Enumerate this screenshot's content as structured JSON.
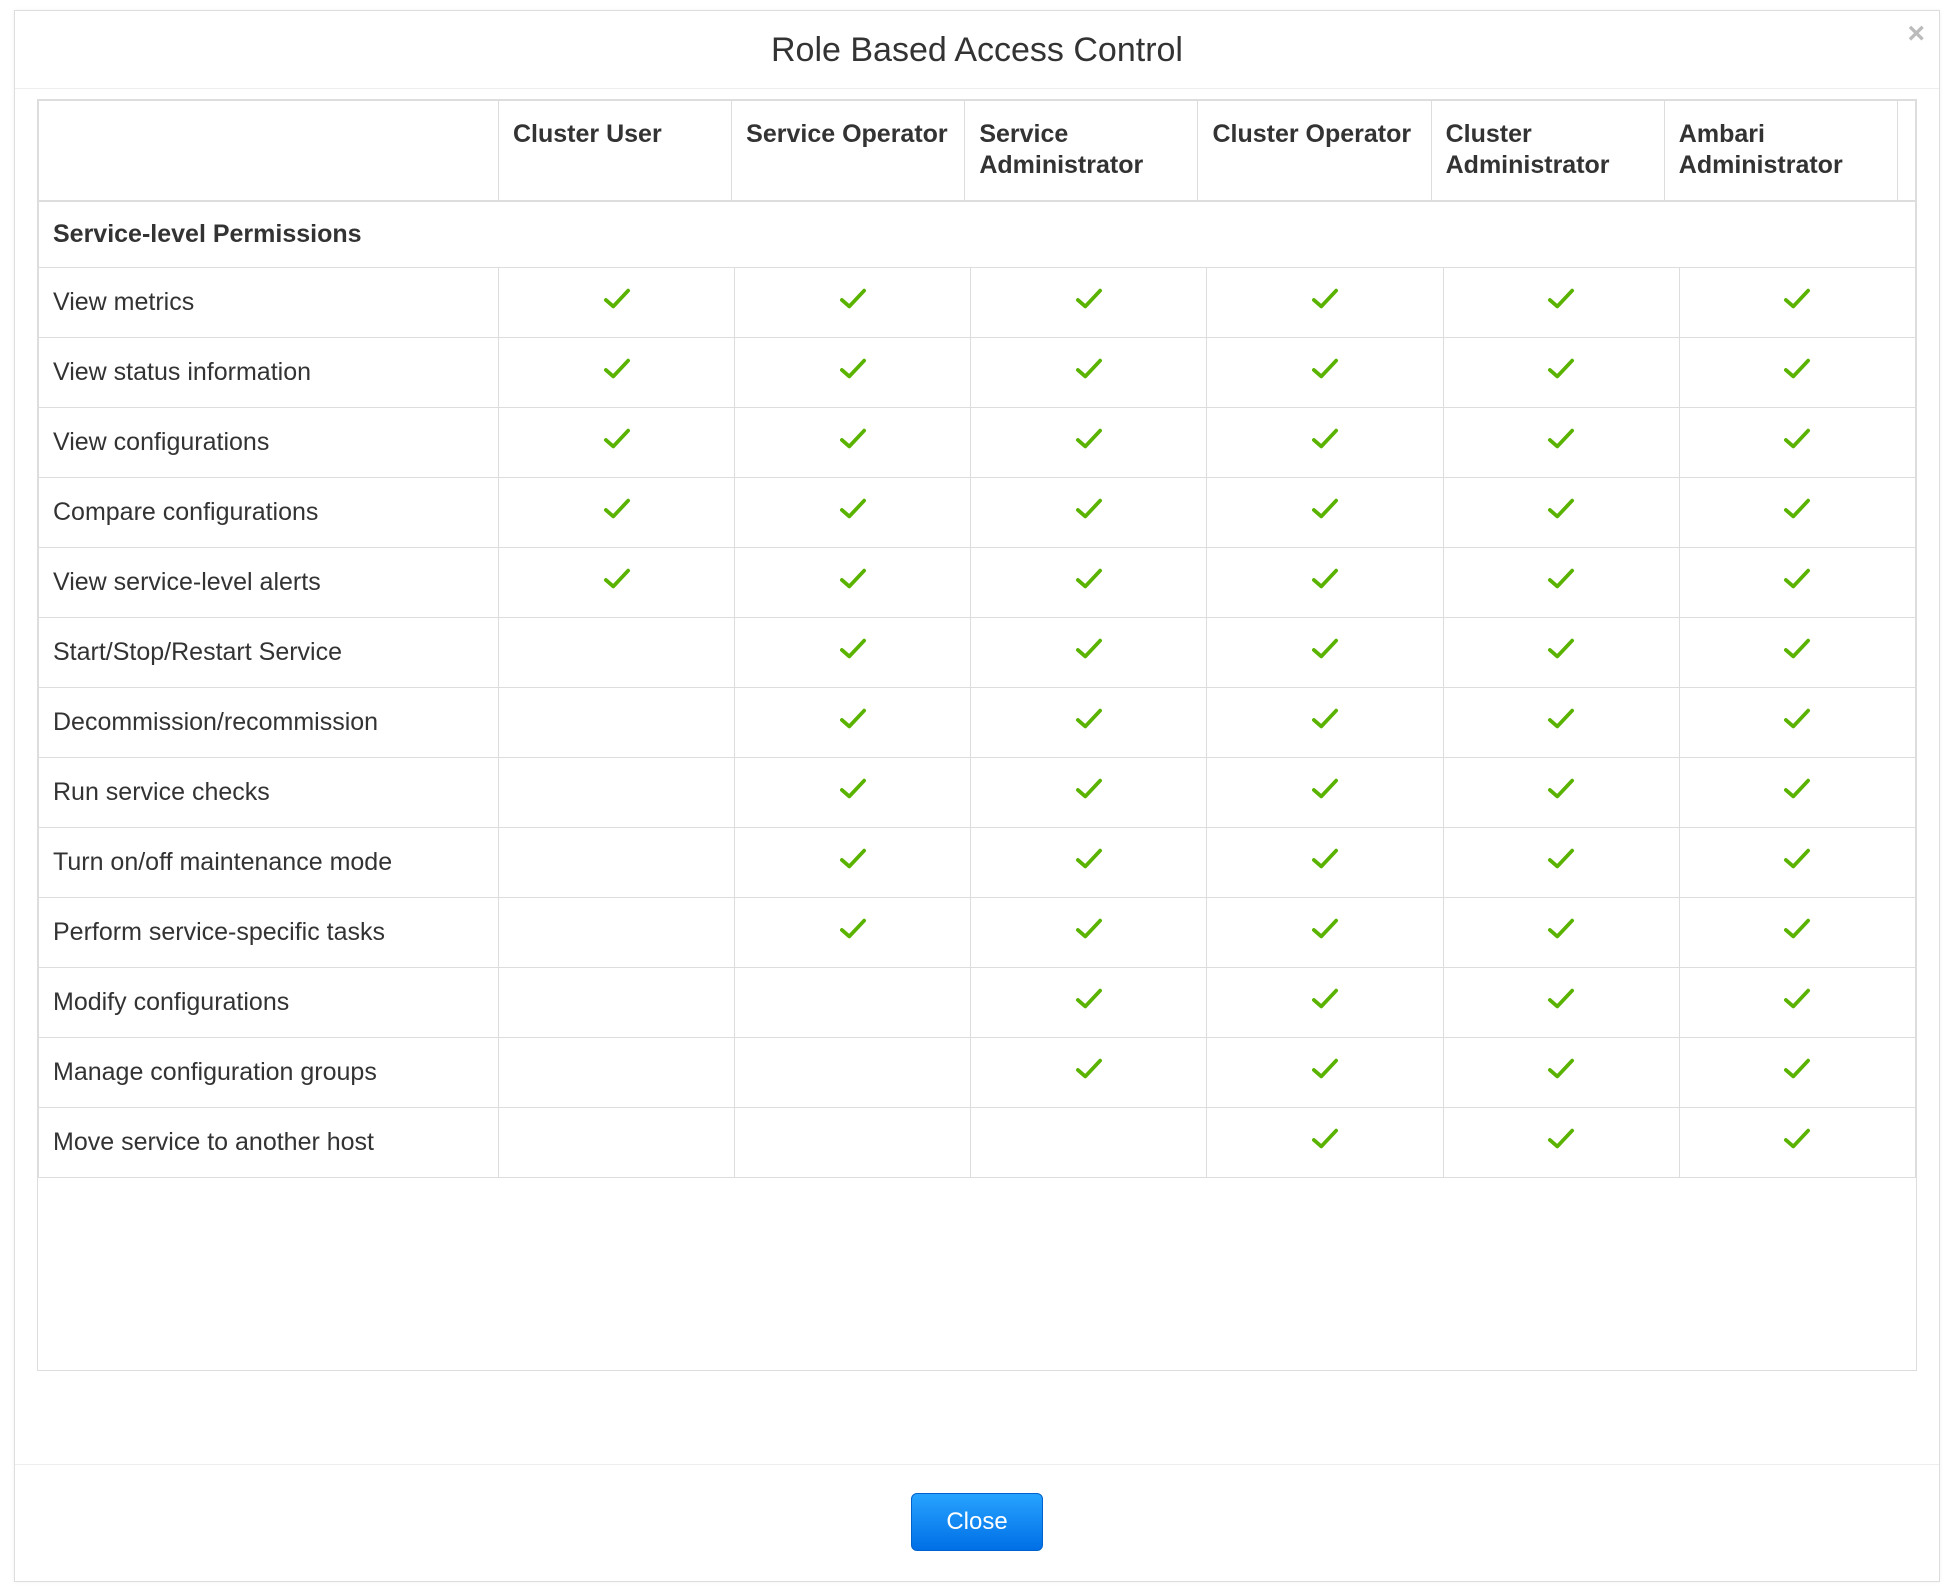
{
  "modal": {
    "title": "Role Based Access Control",
    "close_button_label": "Close",
    "roles": [
      "Cluster User",
      "Service Operator",
      "Service Administrator",
      "Cluster Operator",
      "Cluster Administrator",
      "Ambari Administrator"
    ],
    "section_label": "Service-level Permissions",
    "permissions": [
      {
        "name": "View metrics",
        "grants": [
          true,
          true,
          true,
          true,
          true,
          true
        ]
      },
      {
        "name": "View status information",
        "grants": [
          true,
          true,
          true,
          true,
          true,
          true
        ]
      },
      {
        "name": "View configurations",
        "grants": [
          true,
          true,
          true,
          true,
          true,
          true
        ]
      },
      {
        "name": "Compare configurations",
        "grants": [
          true,
          true,
          true,
          true,
          true,
          true
        ]
      },
      {
        "name": "View service-level alerts",
        "grants": [
          true,
          true,
          true,
          true,
          true,
          true
        ]
      },
      {
        "name": "Start/Stop/Restart Service",
        "grants": [
          false,
          true,
          true,
          true,
          true,
          true
        ]
      },
      {
        "name": "Decommission/recommission",
        "grants": [
          false,
          true,
          true,
          true,
          true,
          true
        ]
      },
      {
        "name": "Run service checks",
        "grants": [
          false,
          true,
          true,
          true,
          true,
          true
        ]
      },
      {
        "name": "Turn on/off maintenance mode",
        "grants": [
          false,
          true,
          true,
          true,
          true,
          true
        ]
      },
      {
        "name": "Perform service-specific tasks",
        "grants": [
          false,
          true,
          true,
          true,
          true,
          true
        ]
      },
      {
        "name": "Modify configurations",
        "grants": [
          false,
          false,
          true,
          true,
          true,
          true
        ]
      },
      {
        "name": "Manage configuration groups",
        "grants": [
          false,
          false,
          true,
          true,
          true,
          true
        ]
      },
      {
        "name": "Move service to another host",
        "grants": [
          false,
          false,
          false,
          true,
          true,
          true
        ]
      }
    ]
  }
}
